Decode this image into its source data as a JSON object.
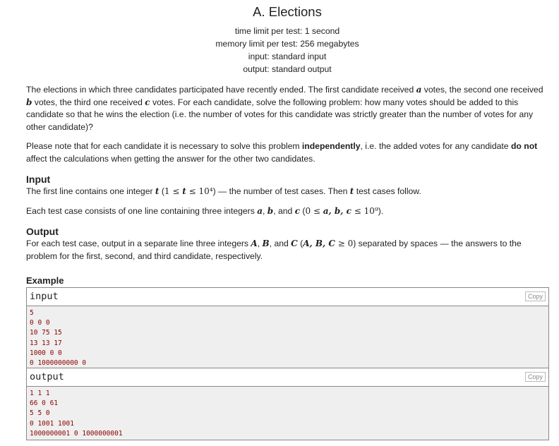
{
  "header": {
    "title": "A. Elections",
    "time_limit": "time limit per test: 1 second",
    "memory_limit": "memory limit per test: 256 megabytes",
    "input": "input: standard input",
    "output": "output: standard output"
  },
  "legend": [
    [
      {
        "t": "The elections in which three candidates participated have recently ended. The first candidate received "
      },
      {
        "t": "a",
        "c": "m"
      },
      {
        "t": " votes, the second one received "
      },
      {
        "t": "b",
        "c": "m"
      },
      {
        "t": " votes, the third one received "
      },
      {
        "t": "c",
        "c": "m"
      },
      {
        "t": " votes. For each candidate, solve the following problem: how many votes should be added to this candidate so that he wins the election (i.e. the number of votes for this candidate was strictly greater than the number of votes for any other candidate)?"
      }
    ],
    [
      {
        "t": "Please note that for each candidate it is necessary to solve this problem "
      },
      {
        "t": "independently",
        "c": "b"
      },
      {
        "t": ", i.e. the added votes for any candidate "
      },
      {
        "t": "do not",
        "c": "b"
      },
      {
        "t": " affect the calculations when getting the answer for the other two candidates."
      }
    ]
  ],
  "input_section": {
    "title": "Input",
    "paragraphs": [
      [
        {
          "t": "The first line contains one integer "
        },
        {
          "t": "t",
          "c": "m"
        },
        {
          "t": " ("
        },
        {
          "t": "1 ≤ ",
          "c": "mn"
        },
        {
          "t": "t",
          "c": "m"
        },
        {
          "t": " ≤ 10⁴",
          "c": "mn"
        },
        {
          "t": ") — the number of test cases. Then "
        },
        {
          "t": "t",
          "c": "m"
        },
        {
          "t": " test cases follow."
        }
      ],
      [
        {
          "t": "Each test case consists of one line containing three integers "
        },
        {
          "t": "a",
          "c": "m"
        },
        {
          "t": ", "
        },
        {
          "t": "b",
          "c": "m"
        },
        {
          "t": ", and "
        },
        {
          "t": "c",
          "c": "m"
        },
        {
          "t": " ("
        },
        {
          "t": "0 ≤ ",
          "c": "mn"
        },
        {
          "t": "a, b, c",
          "c": "m"
        },
        {
          "t": " ≤ 10⁹",
          "c": "mn"
        },
        {
          "t": ")."
        }
      ]
    ]
  },
  "output_section": {
    "title": "Output",
    "paragraphs": [
      [
        {
          "t": "For each test case, output in a separate line three integers "
        },
        {
          "t": "A",
          "c": "m"
        },
        {
          "t": ", "
        },
        {
          "t": "B",
          "c": "m"
        },
        {
          "t": ", and "
        },
        {
          "t": "C",
          "c": "m"
        },
        {
          "t": " ("
        },
        {
          "t": "A, B, C",
          "c": "m"
        },
        {
          "t": " ≥ 0",
          "c": "mn"
        },
        {
          "t": ") separated by spaces — the answers to the problem for the first, second, and third candidate, respectively."
        }
      ]
    ]
  },
  "example": {
    "title": "Example",
    "input_label": "input",
    "output_label": "output",
    "copy_label": "Copy",
    "input_lines": [
      "5",
      "0 0 0",
      "10 75 15",
      "13 13 17",
      "1000 0 0",
      "0 1000000000 0"
    ],
    "output_lines": [
      "1 1 1",
      "66 0 61",
      "5 5 0",
      "0 1001 1001",
      "1000000001 0 1000000001"
    ]
  }
}
